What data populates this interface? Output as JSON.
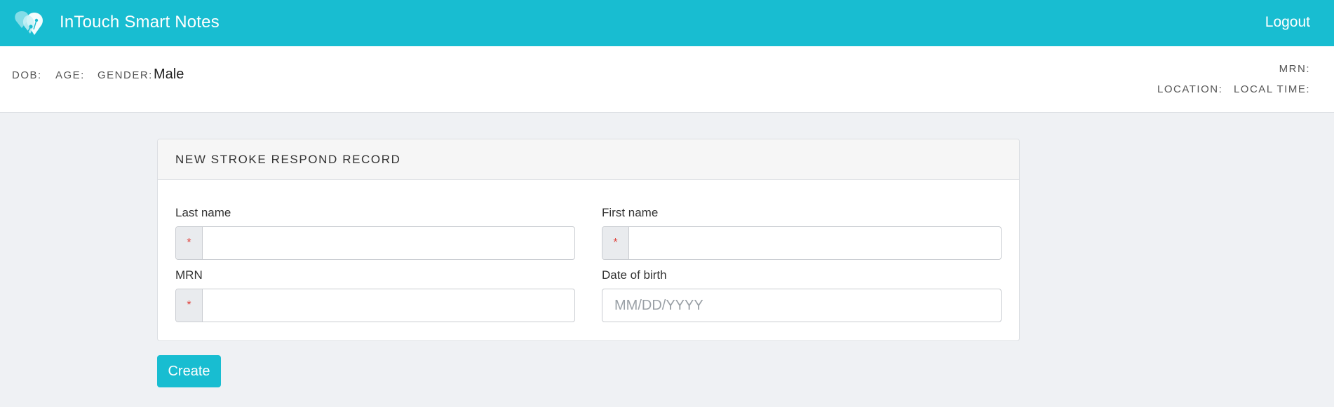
{
  "header": {
    "app_title": "InTouch Smart Notes",
    "logout_label": "Logout",
    "brand_color": "#18bdd1"
  },
  "patient": {
    "dob_label": "DOB:",
    "dob_value": "",
    "age_label": "AGE:",
    "age_value": "",
    "gender_label": "GENDER:",
    "gender_value": "Male",
    "mrn_label": "MRN:",
    "mrn_value": "",
    "location_label": "LOCATION:",
    "location_value": "",
    "local_time_label": "LOCAL TIME:",
    "local_time_value": ""
  },
  "form": {
    "title": "NEW STROKE RESPOND RECORD",
    "required_marker": "*",
    "fields": {
      "last_name": {
        "label": "Last name",
        "value": "",
        "required": true
      },
      "first_name": {
        "label": "First name",
        "value": "",
        "required": true
      },
      "mrn": {
        "label": "MRN",
        "value": "",
        "required": true
      },
      "dob": {
        "label": "Date of birth",
        "value": "",
        "placeholder": "MM/DD/YYYY",
        "required": false
      }
    },
    "create_label": "Create"
  }
}
